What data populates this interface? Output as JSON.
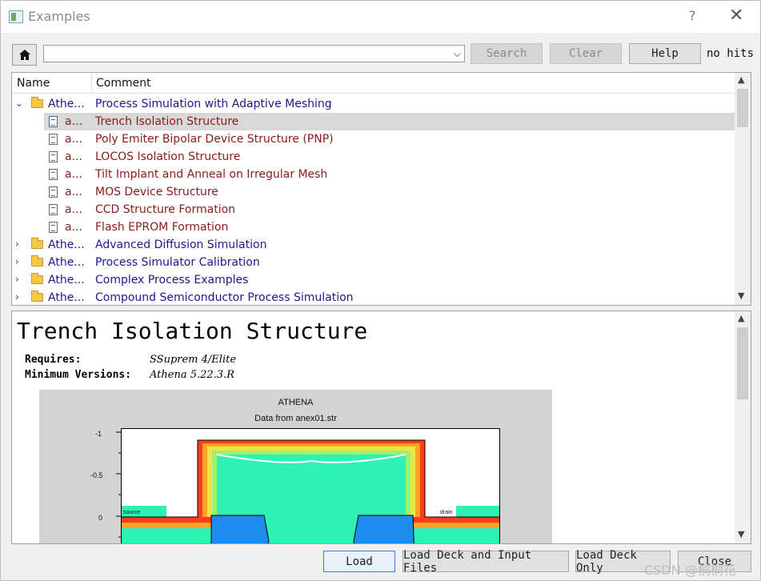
{
  "window": {
    "title": "Examples",
    "help": "?",
    "close": "✕"
  },
  "toolbar": {
    "search_value": "",
    "search_label": "Search",
    "clear_label": "Clear",
    "help_label": "Help",
    "status": "no hits"
  },
  "tree": {
    "headers": {
      "name": "Name",
      "comment": "Comment"
    },
    "rows": [
      {
        "name": "Athe...",
        "comment": "Process Simulation with Adaptive Meshing",
        "type": "folder",
        "expanded": true
      },
      {
        "name": "a...",
        "comment": "Trench Isolation Structure",
        "type": "doc",
        "selected": true
      },
      {
        "name": "a...",
        "comment": "Poly Emiter Bipolar Device Structure (PNP)",
        "type": "doc"
      },
      {
        "name": "a...",
        "comment": "LOCOS Isolation Structure",
        "type": "doc"
      },
      {
        "name": "a...",
        "comment": "Tilt Implant and Anneal on Irregular Mesh",
        "type": "doc"
      },
      {
        "name": "a...",
        "comment": "MOS Device Structure",
        "type": "doc"
      },
      {
        "name": "a...",
        "comment": "CCD Structure Formation",
        "type": "doc"
      },
      {
        "name": "a...",
        "comment": "Flash EPROM Formation",
        "type": "doc"
      },
      {
        "name": "Athe...",
        "comment": "Advanced Diffusion Simulation",
        "type": "folder"
      },
      {
        "name": "Athe...",
        "comment": "Process Simulator Calibration",
        "type": "folder"
      },
      {
        "name": "Athe...",
        "comment": "Complex Process Examples",
        "type": "folder"
      },
      {
        "name": "Athe...",
        "comment": "Compound Semiconductor Process Simulation",
        "type": "folder"
      }
    ]
  },
  "preview": {
    "title": "Trench Isolation Structure",
    "requires_label": "Requires:",
    "requires_value": "SSuprem 4/Elite",
    "min_versions_label": "Minimum Versions:",
    "min_versions_value": "Athena 5.22.3.R",
    "plot": {
      "title": "ATHENA",
      "subtitle": "Data from anex01.str",
      "yticks": [
        "-1",
        "-0.5",
        "0"
      ],
      "labels": {
        "left": "source",
        "right": "drain"
      }
    }
  },
  "buttons": {
    "load": "Load",
    "load_deck_input": "Load Deck and Input Files",
    "load_deck_only": "Load Deck Only",
    "close": "Close"
  },
  "watermark": "CSDN @桐桐花"
}
